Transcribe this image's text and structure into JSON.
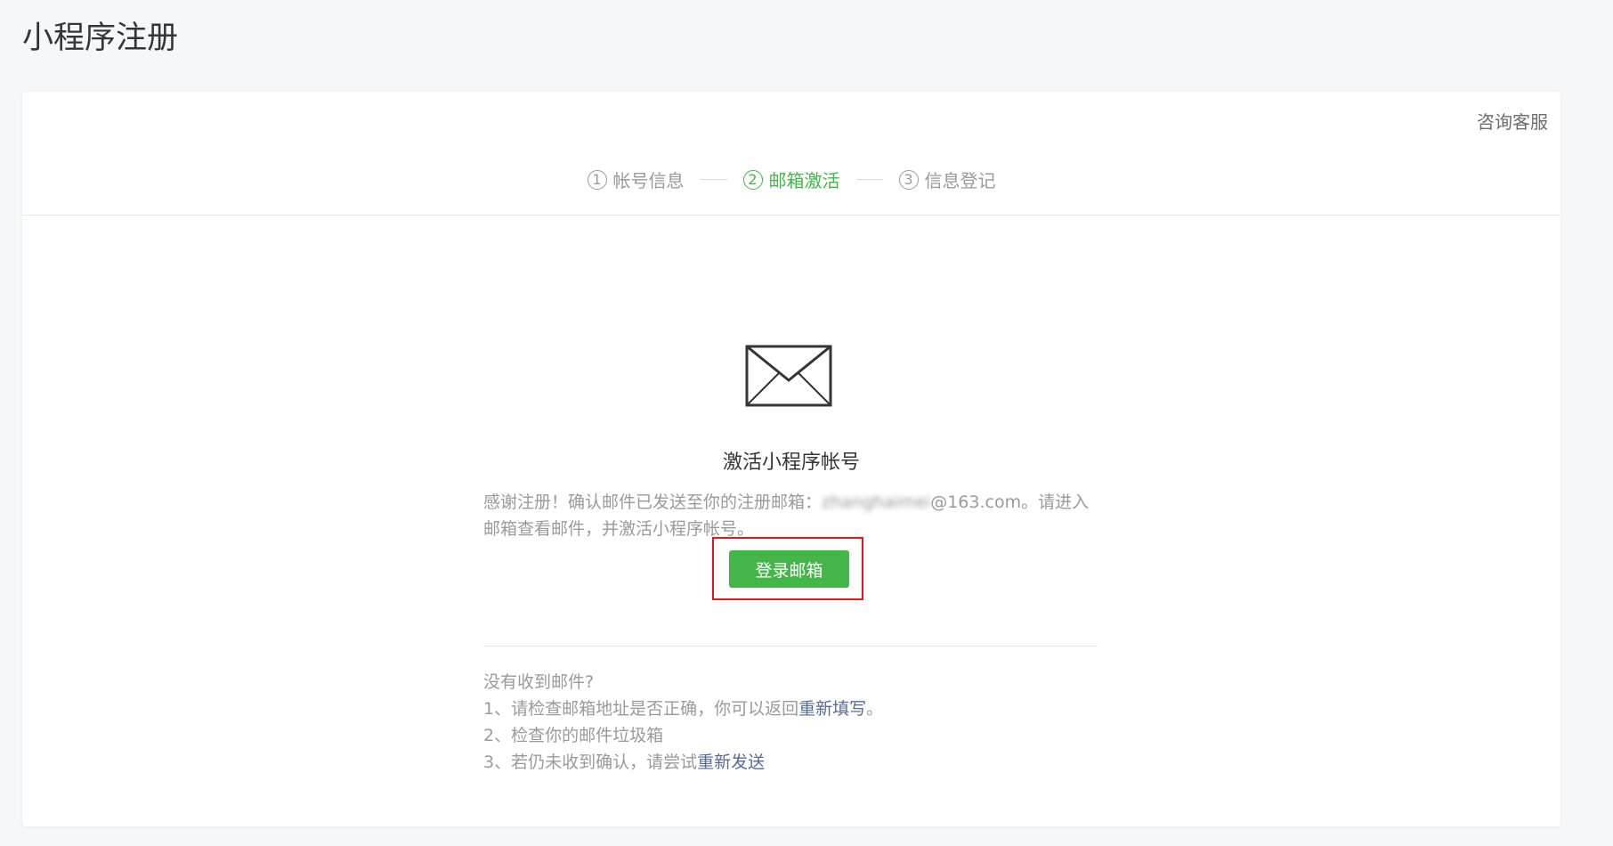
{
  "page": {
    "title": "小程序注册"
  },
  "header": {
    "service_link": "咨询客服"
  },
  "steps": [
    {
      "number": "1",
      "label": "帐号信息",
      "state": "done"
    },
    {
      "number": "2",
      "label": "邮箱激活",
      "state": "active"
    },
    {
      "number": "3",
      "label": "信息登记",
      "state": "pending"
    }
  ],
  "main": {
    "icon": "envelope-icon",
    "title": "激活小程序帐号",
    "desc_prefix": "感谢注册！确认邮件已发送至你的注册邮箱：",
    "email_hidden": "zhanghaimei",
    "email_suffix": "@163.com。请进入邮箱查看邮件，并激活小程序帐号。",
    "login_button": "登录邮箱"
  },
  "help": {
    "heading": "没有收到邮件?",
    "item1_prefix": "1、请检查邮箱地址是否正确，你可以返回",
    "item1_link": "重新填写",
    "item1_suffix": "。",
    "item2": "2、检查你的邮件垃圾箱",
    "item3_prefix": "3、若仍未收到确认，请尝试",
    "item3_link": "重新发送"
  },
  "colors": {
    "accent": "#44b549",
    "highlight_box": "#e0171f",
    "link": "#576b95",
    "muted_text": "#9a9a9a"
  }
}
